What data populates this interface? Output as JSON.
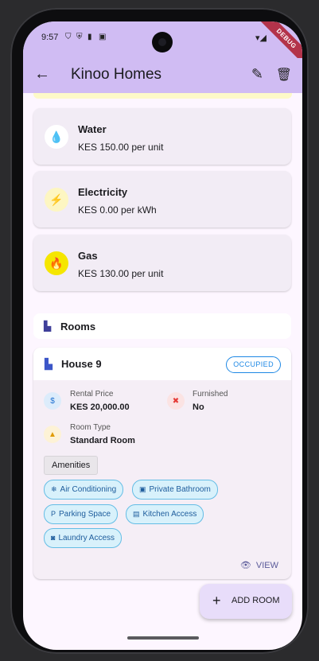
{
  "status_bar": {
    "time": "9:57",
    "debug_label": "DEBUG"
  },
  "app_bar": {
    "title": "Kinoo Homes"
  },
  "utilities": [
    {
      "name": "Water",
      "rate": "KES 150.00 per unit",
      "icon": "water-drop-icon",
      "color": "#1e88e5"
    },
    {
      "name": "Electricity",
      "rate": "KES 0.00 per kWh",
      "icon": "bolt-icon",
      "color": "#f2c500"
    },
    {
      "name": "Gas",
      "rate": "KES 130.00 per unit",
      "icon": "flame-icon",
      "color": "#f2e600"
    }
  ],
  "rooms_section": {
    "label": "Rooms"
  },
  "room": {
    "name": "House 9",
    "status": "OCCUPIED",
    "rental_price_label": "Rental Price",
    "rental_price": "KES 20,000.00",
    "furnished_label": "Furnished",
    "furnished": "No",
    "room_type_label": "Room Type",
    "room_type": "Standard Room",
    "amenities_label": "Amenities",
    "amenities": [
      "Air Conditioning",
      "Private Bathroom",
      "Parking Space",
      "Kitchen Access",
      "Laundry Access"
    ],
    "view_label": "VIEW"
  },
  "fab": {
    "label": "ADD ROOM"
  }
}
